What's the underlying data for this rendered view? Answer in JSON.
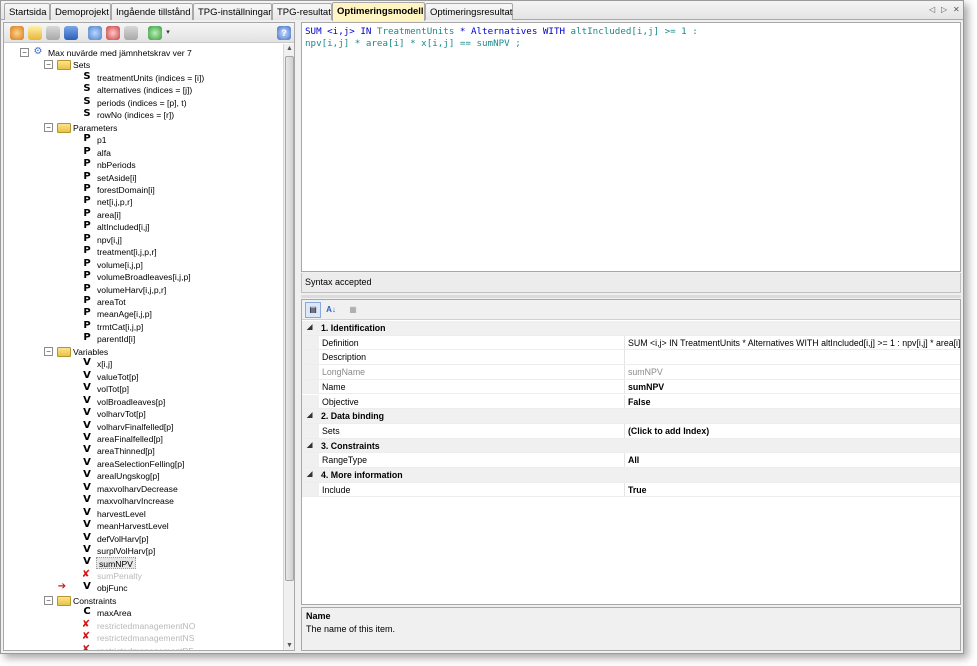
{
  "tabs": [
    {
      "label": "Startsida",
      "active": false
    },
    {
      "label": "Demoprojekt",
      "active": false
    },
    {
      "label": "Ingående tillstånd",
      "active": false
    },
    {
      "label": "TPG-inställningar",
      "active": false
    },
    {
      "label": "TPG-resultat",
      "active": false
    },
    {
      "label": "Optimeringsmodell",
      "active": true
    },
    {
      "label": "Optimeringsresultat",
      "active": false
    }
  ],
  "tab_nav": {
    "left": "◁",
    "right": "▷",
    "close": "✕"
  },
  "tree": {
    "root": "Max nuvärde med jämnhetskrav ver 7",
    "sets_label": "Sets",
    "sets": [
      {
        "letter": "S",
        "label": "treatmentUnits (indices = [i])"
      },
      {
        "letter": "S",
        "label": "alternatives (indices = [j])"
      },
      {
        "letter": "S",
        "label": "periods (indices = [p], t)"
      },
      {
        "letter": "S",
        "label": "rowNo (indices = [r])"
      }
    ],
    "parameters_label": "Parameters",
    "parameters": [
      {
        "letter": "P",
        "label": "p1"
      },
      {
        "letter": "P",
        "label": "alfa"
      },
      {
        "letter": "P",
        "label": "nbPeriods"
      },
      {
        "letter": "P",
        "label": "setAside[i]"
      },
      {
        "letter": "P",
        "label": "forestDomain[i]"
      },
      {
        "letter": "P",
        "label": "net[i,j,p,r]"
      },
      {
        "letter": "P",
        "label": "area[i]"
      },
      {
        "letter": "P",
        "label": "altIncluded[i,j]"
      },
      {
        "letter": "P",
        "label": "npv[i,j]"
      },
      {
        "letter": "P",
        "label": "treatment[i,j,p,r]"
      },
      {
        "letter": "P",
        "label": "volume[i,j,p]"
      },
      {
        "letter": "P",
        "label": "volumeBroadleaves[i,j,p]"
      },
      {
        "letter": "P",
        "label": "volumeHarv[i,j,p,r]"
      },
      {
        "letter": "P",
        "label": "areaTot"
      },
      {
        "letter": "P",
        "label": "meanAge[i,j,p]"
      },
      {
        "letter": "P",
        "label": "trmtCat[i,j,p]"
      },
      {
        "letter": "P",
        "label": "parentId[i]"
      }
    ],
    "variables_label": "Variables",
    "variables": [
      {
        "letter": "V",
        "label": "x[i,j]"
      },
      {
        "letter": "V",
        "label": "valueTot[p]"
      },
      {
        "letter": "V",
        "label": "volTot[p]"
      },
      {
        "letter": "V",
        "label": "volBroadleaves[p]"
      },
      {
        "letter": "V",
        "label": "volharvTot[p]"
      },
      {
        "letter": "V",
        "label": "volharvFinalfelled[p]"
      },
      {
        "letter": "V",
        "label": "areaFinalfelled[p]"
      },
      {
        "letter": "V",
        "label": "areaThinned[p]"
      },
      {
        "letter": "V",
        "label": "areaSelectionFelling[p]"
      },
      {
        "letter": "V",
        "label": "arealUngskog[p]"
      },
      {
        "letter": "V",
        "label": "maxvolharvDecrease"
      },
      {
        "letter": "V",
        "label": "maxvolharvIncrease"
      },
      {
        "letter": "V",
        "label": "harvestLevel"
      },
      {
        "letter": "V",
        "label": "meanHarvestLevel"
      },
      {
        "letter": "V",
        "label": "defVolHarv[p]"
      },
      {
        "letter": "V",
        "label": "surplVolHarv[p]"
      },
      {
        "letter": "V",
        "label": "sumNPV",
        "selected": true
      },
      {
        "letter": "V",
        "label": "sumPenalty",
        "disabled": true
      },
      {
        "letter": "V",
        "label": "objFunc",
        "arrow": true
      }
    ],
    "constraints_label": "Constraints",
    "constraints": [
      {
        "letter": "C",
        "label": "maxArea"
      },
      {
        "letter": "C",
        "label": "restrictedmanagementNO",
        "disabled": true
      },
      {
        "letter": "C",
        "label": "restrictedmanagementNS",
        "disabled": true
      },
      {
        "letter": "C",
        "label": "restrictedmanagementPF",
        "disabled": true
      }
    ]
  },
  "editor": {
    "line1_kw": "SUM <i,j> IN",
    "line1_a": " TreatmentUnits ",
    "line1_kw2": "* Alternatives WITH",
    "line1_b": " altIncluded[i,j] >= 1 :",
    "line2": " npv[i,j] * area[i] * x[i,j] == sumNPV ;"
  },
  "status": "Syntax accepted",
  "properties": [
    {
      "type": "cat",
      "label": "1. Identification"
    },
    {
      "type": "prop",
      "name": "Definition",
      "value": "SUM <i,j> IN TreatmentUnits * Alternatives WITH altIncluded[i,j] >= 1 : npv[i,j] * area[i] * x[i,j] == sumNPV",
      "bold": false
    },
    {
      "type": "prop",
      "name": "Description",
      "value": "",
      "bold": false
    },
    {
      "type": "prop",
      "name": "LongName",
      "value": "sumNPV",
      "bold": false,
      "grey": true
    },
    {
      "type": "prop",
      "name": "Name",
      "value": "sumNPV",
      "bold": true
    },
    {
      "type": "prop",
      "name": "Objective",
      "value": "False",
      "bold": true
    },
    {
      "type": "cat",
      "label": "2. Data binding"
    },
    {
      "type": "prop",
      "name": "Sets",
      "value": "(Click to add Index)",
      "bold": true
    },
    {
      "type": "cat",
      "label": "3. Constraints"
    },
    {
      "type": "prop",
      "name": "RangeType",
      "value": "All",
      "bold": true
    },
    {
      "type": "cat",
      "label": "4. More information"
    },
    {
      "type": "prop",
      "name": "Include",
      "value": "True",
      "bold": true
    }
  ],
  "help": {
    "title": "Name",
    "text": "The name of this item."
  }
}
